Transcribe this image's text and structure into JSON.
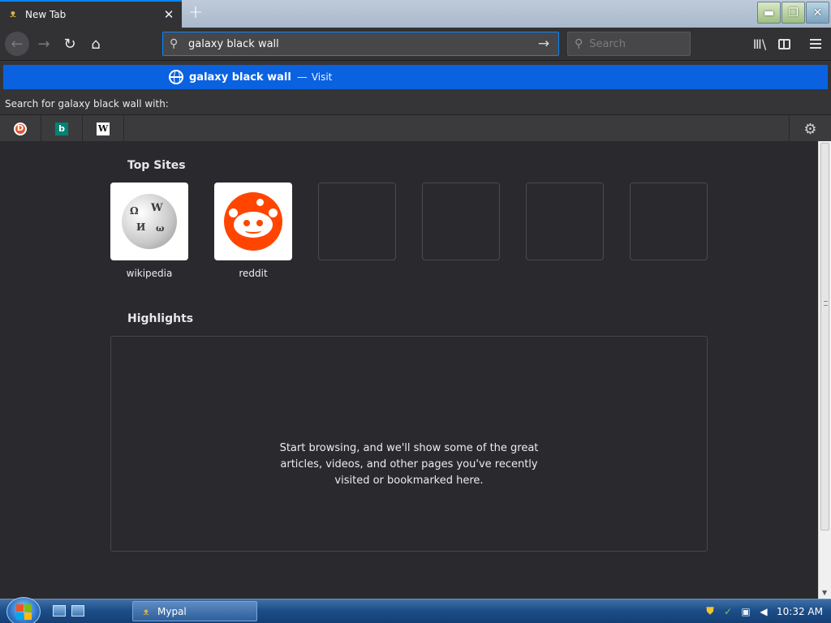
{
  "tab": {
    "title": "New Tab",
    "favicon": "bat-icon",
    "close_glyph": "✕"
  },
  "newtab_glyph": "+",
  "window_buttons": {
    "minimize_glyph": "▬",
    "maximize_glyph": "❐",
    "close_glyph": "✕"
  },
  "nav": {
    "back_glyph": "←",
    "forward_glyph": "→",
    "reload_glyph": "↻",
    "home_glyph": "⌂",
    "library_glyph": "Ⅲ\\"
  },
  "urlbar": {
    "value": "galaxy black wall",
    "search_glyph": "⚲",
    "go_glyph": "→"
  },
  "searchbar": {
    "placeholder": "Search",
    "search_glyph": "⚲"
  },
  "suggestion": {
    "title": "galaxy black wall",
    "separator": "—",
    "action": "Visit"
  },
  "search_with_label": "Search for galaxy black wall with:",
  "engines": [
    {
      "name": "DuckDuckGo",
      "icon": "duckduckgo-icon",
      "glyph": "D"
    },
    {
      "name": "Bing",
      "icon": "bing-icon",
      "glyph": "b"
    },
    {
      "name": "Wikipedia",
      "icon": "wikipedia-icon",
      "glyph": "W"
    }
  ],
  "settings_glyph": "⚙",
  "top_sites": {
    "title": "Top Sites",
    "sites": [
      {
        "label": "wikipedia",
        "icon": "wikipedia-globe-icon"
      },
      {
        "label": "reddit",
        "icon": "reddit-icon"
      }
    ]
  },
  "highlights": {
    "title": "Highlights",
    "message": "Start browsing, and we'll show some of the great articles, videos, and other pages you've recently visited or bookmarked here."
  },
  "taskbar": {
    "task_label": "Mypal",
    "task_icon_glyph": "ᴥ",
    "clock": "10:32 AM",
    "tray_glyphs": {
      "shield": "⛊",
      "flag": "✓",
      "network": "▣",
      "volume": "◀"
    }
  },
  "colors": {
    "accent": "#0a84ff",
    "suggestion_bg": "#0a62e0",
    "content_bg": "#2a2a2e",
    "toolbar_bg": "#323234",
    "reddit": "#ff4500"
  }
}
